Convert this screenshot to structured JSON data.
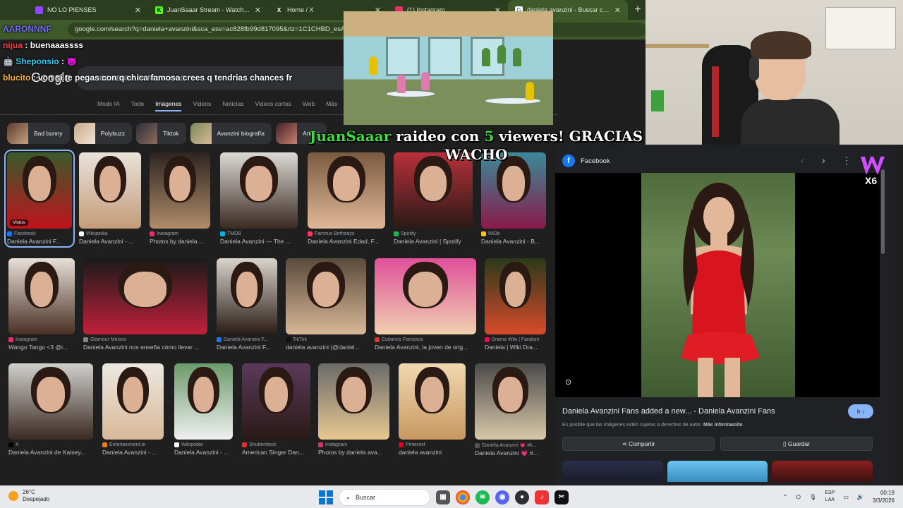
{
  "browser": {
    "tabs": [
      {
        "label": "NO LO PIENSES",
        "icon_color": "#9146ff",
        "active": false
      },
      {
        "label": "JuanSaaar Stream - Watch Live",
        "icon_color": "#53fc18",
        "active": false
      },
      {
        "label": "Home / X",
        "icon_color": "#000000",
        "active": false
      },
      {
        "label": "(1) Instagram",
        "icon_color": "#e1306c",
        "active": false
      },
      {
        "label": "daniela avanzini - Buscar con G",
        "icon_color": "#4285f4",
        "active": true
      }
    ],
    "url": "google.com/search?q=daniela+avanzini&sca_esv=ac828fb99d817095&rlz=1C1CHBD_esAR1"
  },
  "google": {
    "logo": "Google",
    "query": "COCINEBRIA PORFAVOOOO",
    "nav": [
      "Modo IA",
      "Todo",
      "Imágenes",
      "Videos",
      "Noticias",
      "Videos cortos",
      "Web",
      "Más"
    ],
    "chips": [
      "Bad bunny",
      "Polybuzz",
      "Tiktok",
      "Avanzini biografía",
      "Artista"
    ],
    "results": [
      {
        "source": "Facebook",
        "title": "Daniela Avanzini F...",
        "color": "#1877f2"
      },
      {
        "source": "Wikipedia",
        "title": "Daniela Avanzini - ...",
        "color": "#ffffff"
      },
      {
        "source": "Instagram",
        "title": "Photos by daniela ...",
        "color": "#e1306c"
      },
      {
        "source": "TMDB",
        "title": "Daniela Avanzini — The ...",
        "color": "#01b4e4"
      },
      {
        "source": "Famous Birthdays",
        "title": "Daniela Avanzini Edad, F...",
        "color": "#ff3366"
      },
      {
        "source": "Spotify",
        "title": "Daniela Avanzini | Spotify",
        "color": "#1db954"
      },
      {
        "source": "IMDb",
        "title": "Daniela Avanzini - B...",
        "color": "#f5c518"
      },
      {
        "source": "Instagram",
        "title": "Wango Tango <3 @i...",
        "color": "#e1306c"
      },
      {
        "source": "Glamour México",
        "title": "Daniela Avanzini nos enseña cómo llevar ...",
        "color": "#888888"
      },
      {
        "source": "Daniela Avanzini F...",
        "title": "Daniela Avanzini F...",
        "color": "#1877f2"
      },
      {
        "source": "TikTok",
        "title": "daniela avanzini (@daniel...",
        "color": "#111111"
      },
      {
        "source": "Cubanos Famosos",
        "title": "Daniela Avanzini, la joven de orig...",
        "color": "#d33"
      },
      {
        "source": "Drama Wiki | Fandom",
        "title": "Daniela | Wiki Dra...",
        "color": "#fa005a"
      },
      {
        "source": "X",
        "title": "Daniela Avanzini de Katsey...",
        "color": "#000000"
      },
      {
        "source": "Entertainment.ie",
        "title": "Daniela Avanzini - ...",
        "color": "#f57c00"
      },
      {
        "source": "Wikipedia",
        "title": "Daniela Avanzini - ...",
        "color": "#ffffff"
      },
      {
        "source": "Shutterstock",
        "title": "American Singer Dan...",
        "color": "#ee2b24"
      },
      {
        "source": "Instagram",
        "title": "Photos by daniela ava...",
        "color": "#e1306c"
      },
      {
        "source": "Pinterest",
        "title": "daniela avanzini",
        "color": "#e60023"
      },
      {
        "source": "Daniela Avanzini 💗 #k...",
        "title": "Daniela Avanzini 💗 #...",
        "color": "#555555"
      }
    ],
    "seen_label": "Vistos"
  },
  "chat": [
    {
      "user": "AARONNNF",
      "user_color": "#7b6cff",
      "text": ""
    },
    {
      "user": "nijua",
      "user_color": "#ff3b3b",
      "text": "buenaaassss"
    },
    {
      "user": "Sheponsio",
      "user_color": "#22d4ff",
      "text": "😈"
    },
    {
      "user": "blucito",
      "user_color": "#ffb21e",
      "text": "von si te pegas con q chica famosa crees q tendrias chances fr"
    }
  ],
  "raid": {
    "streamer": "JuanSaaar",
    "text_before": " raideo con ",
    "count": "5",
    "text_after": " viewers! GRACIAS WACHO"
  },
  "panel": {
    "source": "Facebook",
    "title": "Daniela Avanzini Fans added a new... - Daniela Avanzini Fans",
    "go_label": "Ir ›",
    "copyright_note": "Es posible que las imágenes estén sujetas a derechos de autor.",
    "more_info": "Más información",
    "share_label": "Compartir",
    "save_label": "Guardar"
  },
  "overlay_logo": {
    "letter": "W",
    "multiplier": "X6"
  },
  "taskbar": {
    "temp": "26°C",
    "weather": "Despejado",
    "search_placeholder": "Buscar",
    "lang": "ESP",
    "lang2": "LAA",
    "time": "00:19",
    "date": "3/3/2026"
  }
}
